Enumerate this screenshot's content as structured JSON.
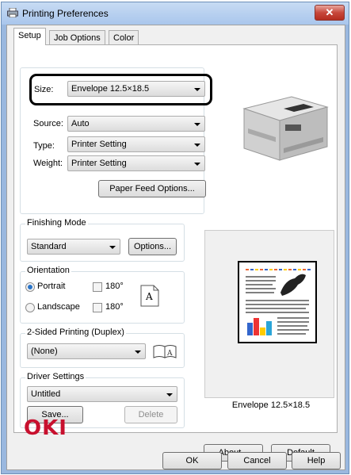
{
  "window": {
    "title": "Printing Preferences",
    "close_label": "✕"
  },
  "tabs": [
    {
      "label": "Setup"
    },
    {
      "label": "Job Options"
    },
    {
      "label": "Color"
    }
  ],
  "media": {
    "size_label": "Size:",
    "size_value": "Envelope 12.5×18.5",
    "source_label": "Source:",
    "source_value": "Auto",
    "type_label": "Type:",
    "type_value": "Printer Setting",
    "weight_label": "Weight:",
    "weight_value": "Printer Setting",
    "paper_feed_button": "Paper Feed Options..."
  },
  "finishing": {
    "label": "Finishing Mode",
    "value": "Standard",
    "options_button": "Options..."
  },
  "orientation": {
    "label": "Orientation",
    "portrait": "Portrait",
    "landscape": "Landscape",
    "rotate_label": "180°",
    "glyph": "A"
  },
  "duplex": {
    "label": "2-Sided Printing (Duplex)",
    "value": "(None)"
  },
  "driver": {
    "label": "Driver Settings",
    "value": "Untitled",
    "save_button": "Save...",
    "delete_button": "Delete"
  },
  "preview": {
    "caption": "Envelope 12.5×18.5"
  },
  "brand": {
    "logo": "OKI",
    "color": "#c8102e"
  },
  "footer": {
    "about": "About...",
    "default": "Default",
    "ok": "OK",
    "cancel": "Cancel",
    "help": "Help"
  }
}
